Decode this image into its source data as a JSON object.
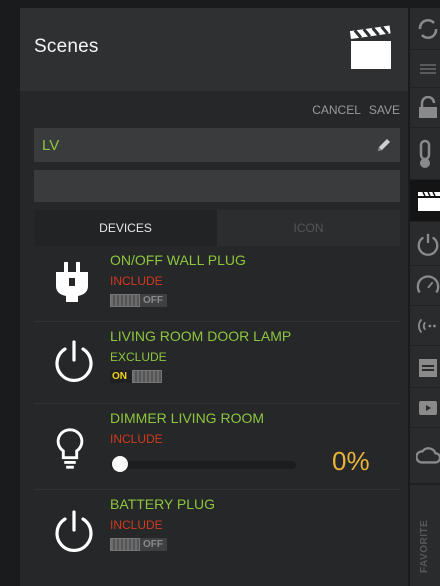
{
  "header": {
    "title": "Scenes",
    "icon": "clapperboard-icon"
  },
  "actions": {
    "cancel": "CANCEL",
    "save": "SAVE"
  },
  "scene_name": {
    "value": "LV",
    "icon": "pencil-icon"
  },
  "description": {
    "value": ""
  },
  "tabs": [
    {
      "label": "DEVICES",
      "active": true
    },
    {
      "label": "ICON",
      "active": false
    }
  ],
  "devices": [
    {
      "name": "ON/OFF WALL PLUG",
      "status": "INCLUDE",
      "icon": "plug-icon",
      "toggle_label": "OFF",
      "on": false
    },
    {
      "name": "LIVING ROOM DOOR LAMP",
      "status": "EXCLUDE",
      "icon": "power-icon",
      "toggle_label": "ON",
      "on": true
    },
    {
      "name": "DIMMER LIVING ROOM",
      "status": "INCLUDE",
      "icon": "bulb-icon",
      "level": "0%",
      "level_fraction": 0
    },
    {
      "name": "BATTERY PLUG",
      "status": "INCLUDE",
      "icon": "power-icon",
      "toggle_label": "OFF",
      "on": false
    }
  ],
  "sidebar": {
    "items": [
      "sync-icon",
      "menu-icon",
      "lock-icon",
      "thermometer-icon",
      "clapperboard-icon",
      "power-icon",
      "gauge-icon",
      "signal-icon",
      "calendar-icon",
      "video-icon",
      "cloud-icon"
    ],
    "active_index": 4,
    "favorite_label": "FAVORITE"
  },
  "colors": {
    "accent_green": "#8cc63f",
    "include_red": "#d03a1f",
    "on_yellow": "#f2d21c",
    "percent_orange": "#e9b43a"
  }
}
